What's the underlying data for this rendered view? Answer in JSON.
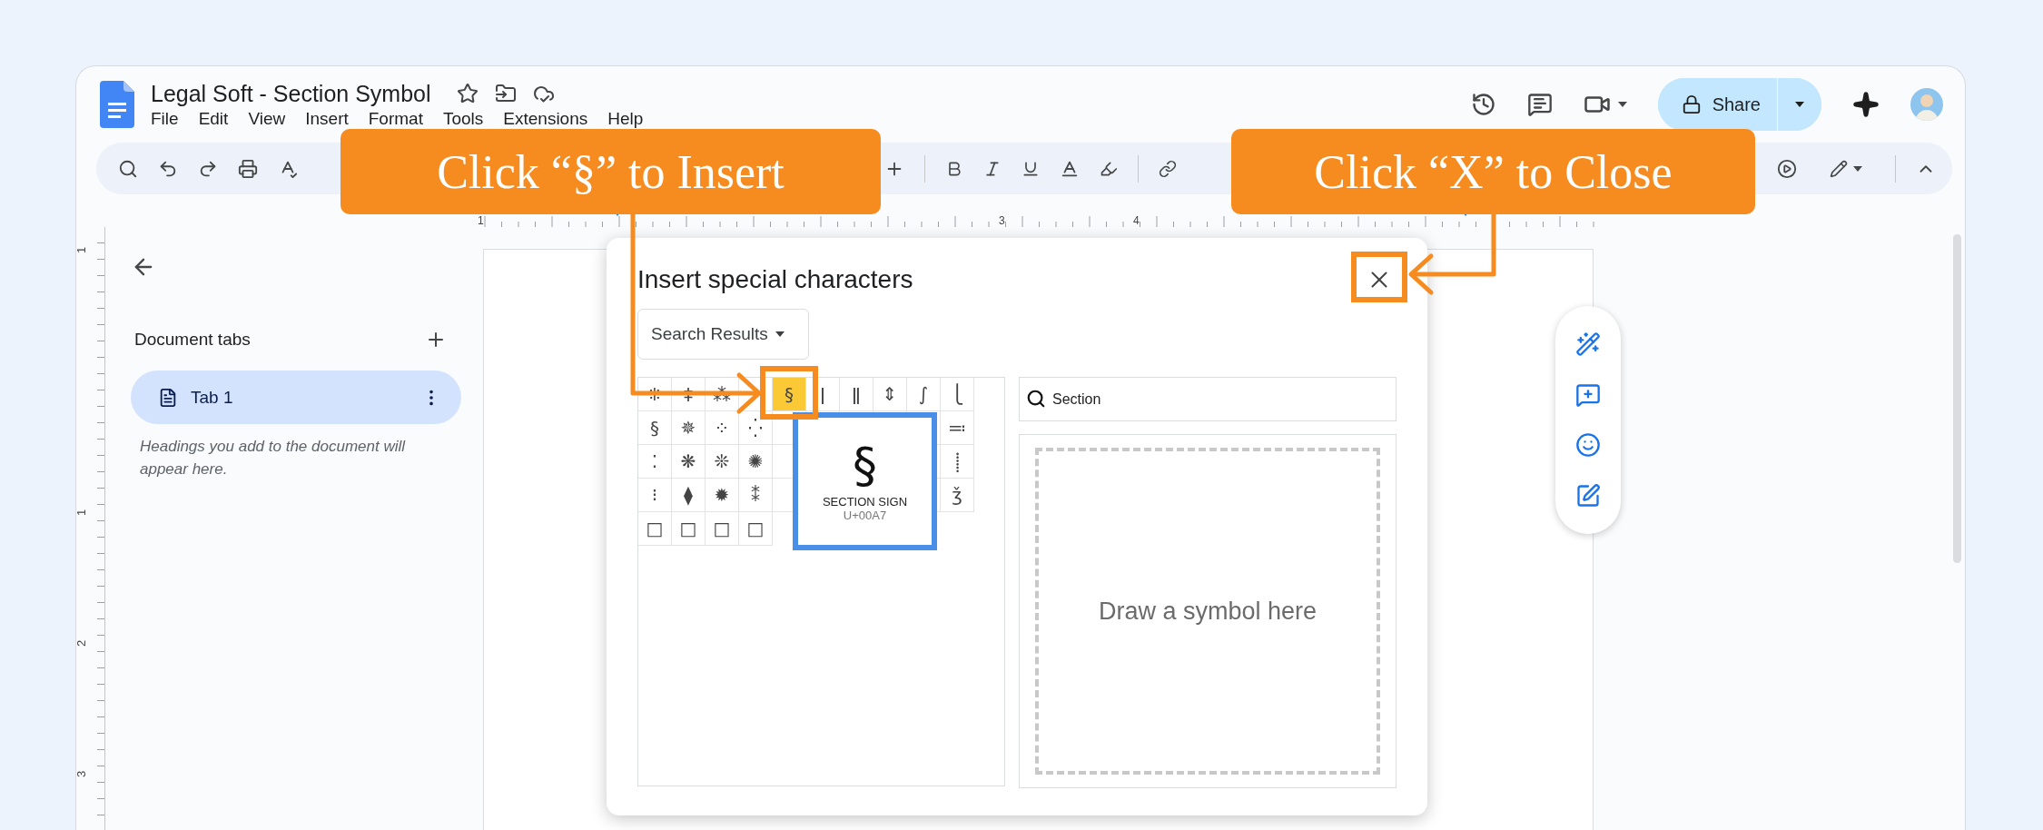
{
  "document": {
    "title": "Legal Soft - Section Symbol"
  },
  "menu": [
    "File",
    "Edit",
    "View",
    "Insert",
    "Format",
    "Tools",
    "Extensions",
    "Help"
  ],
  "share_button": {
    "label": "Share"
  },
  "ruler": {
    "labels": [
      "1",
      "3",
      "4"
    ]
  },
  "vertical_ruler": {
    "labels": [
      "1",
      "1",
      "2",
      "3"
    ]
  },
  "sidebar": {
    "heading": "Document tabs",
    "tabs": [
      {
        "label": "Tab 1",
        "selected": true
      }
    ],
    "hint": "Headings you add to the document will appear here."
  },
  "dialog": {
    "title": "Insert special characters",
    "category": "Search Results",
    "grid": [
      {
        "start": [
          {
            "char": "⁜",
            "selected": false
          },
          {
            "char": "‡",
            "selected": false
          },
          {
            "char": "⁂",
            "selected": false
          }
        ],
        "end": [
          {
            "char": "§",
            "selected": true
          },
          {
            "char": "ǀ",
            "selected": false
          },
          {
            "char": "ǁ",
            "selected": false
          },
          {
            "char": "⇕",
            "selected": false
          },
          {
            "char": "∫",
            "selected": false
          },
          {
            "char": "⎩",
            "selected": false
          }
        ]
      },
      {
        "start": [
          {
            "char": "§",
            "selected": false
          },
          {
            "char": "✵",
            "selected": false
          },
          {
            "char": "⁘",
            "selected": false
          },
          {
            "char": "⁛",
            "selected": false
          }
        ],
        "end": [
          {
            "char": "≕",
            "selected": false
          }
        ]
      },
      {
        "start": [
          {
            "char": "⁚",
            "selected": false
          },
          {
            "char": "❋",
            "selected": false
          },
          {
            "char": "❊",
            "selected": false
          },
          {
            "char": "✺",
            "selected": false
          }
        ],
        "end": [
          {
            "char": "⸽",
            "selected": false
          }
        ]
      },
      {
        "start": [
          {
            "char": "⁝",
            "selected": false
          },
          {
            "char": "⧫",
            "selected": false
          },
          {
            "char": "✹",
            "selected": false
          },
          {
            "char": "⁑",
            "selected": false
          }
        ],
        "end": [
          {
            "char": "ǯ",
            "selected": false
          }
        ]
      },
      {
        "start": [
          {
            "char": "□",
            "selected": false
          },
          {
            "char": "□",
            "selected": false
          },
          {
            "char": "□",
            "selected": false
          },
          {
            "char": "□",
            "selected": false
          }
        ]
      }
    ],
    "preview": {
      "char": "§",
      "name": "SECTION SIGN",
      "code": "U+00A7"
    },
    "search": {
      "value": "Section"
    },
    "draw_area": {
      "prompt": "Draw a symbol here"
    }
  },
  "callouts": [
    {
      "text": "Click “§” to Insert"
    },
    {
      "text": "Click “X” to Close"
    }
  ]
}
